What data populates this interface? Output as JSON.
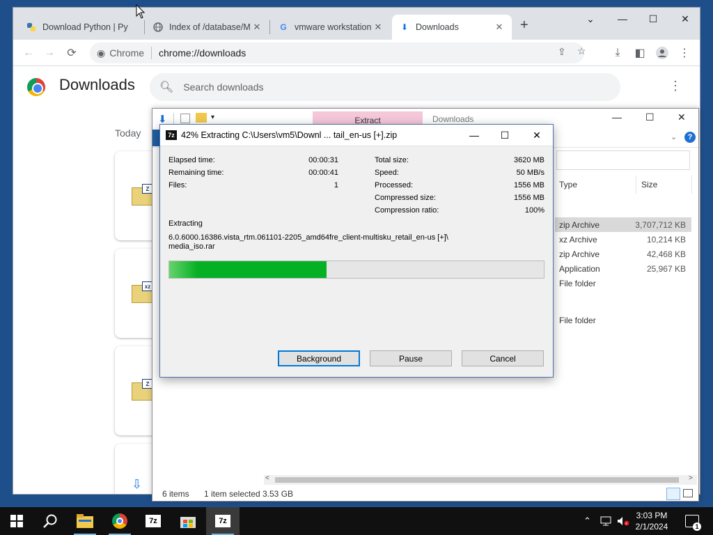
{
  "chrome": {
    "tabs": [
      {
        "title": "Download Python | Py",
        "icon": "python-icon"
      },
      {
        "title": "Index of /database/M",
        "icon": "page-icon"
      },
      {
        "title": "vmware workstation -",
        "icon": "google-icon"
      },
      {
        "title": "Downloads",
        "icon": "download-icon"
      }
    ],
    "new_tab": "+",
    "omnibox": {
      "site": "Chrome",
      "url": "chrome://downloads"
    },
    "downloads_title": "Downloads",
    "search_placeholder": "Search downloads",
    "section_today": "Today",
    "cards": [
      {
        "badge": "Z"
      },
      {
        "badge": "xz"
      },
      {
        "badge": "Z"
      },
      {
        "badge": ""
      }
    ]
  },
  "explorer": {
    "extract_tab": "Extract",
    "location": "Downloads",
    "columns": {
      "type": "Type",
      "size": "Size"
    },
    "rows": [
      {
        "type": "zip Archive",
        "size": "3,707,712 KB",
        "selected": true
      },
      {
        "type": "xz Archive",
        "size": "10,214 KB"
      },
      {
        "type": "zip Archive",
        "size": "42,468 KB"
      },
      {
        "type": "Application",
        "size": "25,967 KB"
      },
      {
        "type": "File folder",
        "size": ""
      },
      {
        "type": "File folder",
        "size": ""
      }
    ],
    "status": {
      "items": "6 items",
      "selected": "1 item selected",
      "size": "3.53 GB"
    }
  },
  "zip_dialog": {
    "icon_text": "7z",
    "title": "42% Extracting C:\\Users\\vm5\\Downl ... tail_en-us [+].zip",
    "left_stats": [
      {
        "label": "Elapsed time:",
        "value": "00:00:31"
      },
      {
        "label": "Remaining time:",
        "value": "00:00:41"
      },
      {
        "label": "Files:",
        "value": "1"
      }
    ],
    "right_stats": [
      {
        "label": "Total size:",
        "value": "3620 MB"
      },
      {
        "label": "Speed:",
        "value": "50 MB/s"
      },
      {
        "label": "Processed:",
        "value": "1556 MB"
      },
      {
        "label": "Compressed size:",
        "value": "1556 MB"
      },
      {
        "label": "Compression ratio:",
        "value": "100%"
      }
    ],
    "extracting_label": "Extracting",
    "current_file_line1": "6.0.6000.16386.vista_rtm.061101-2205_amd64fre_client-multisku_retail_en-us [+]\\",
    "current_file_line2": "media_iso.rar",
    "progress": 0.42,
    "buttons": {
      "background": "Background",
      "pause": "Pause",
      "cancel": "Cancel"
    }
  },
  "taskbar": {
    "apps": [
      "windows-start-icon",
      "search-icon",
      "file-explorer-icon",
      "chrome-icon",
      "7zip-icon",
      "store-icon",
      "7zip-active-icon"
    ],
    "app_label": "7z",
    "time": "3:03 PM",
    "date": "2/1/2024",
    "notifications": "1"
  },
  "colors": {
    "progress_green": "#06b025",
    "explorer_selected_row": "#d9d9d9",
    "extract_tab": "#f4c7d9",
    "taskbar": "#101010"
  }
}
